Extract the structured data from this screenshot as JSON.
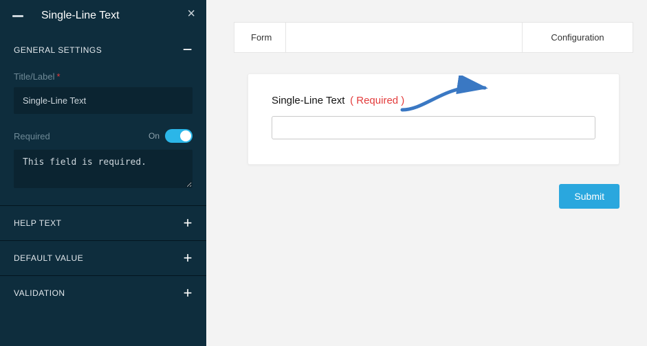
{
  "colors": {
    "sidebar_bg": "#0e2d3d",
    "accent": "#2aa7de",
    "toggle_on": "#2bb6e8",
    "required": "#e33b3b"
  },
  "sidebar": {
    "panel_title": "Single-Line Text",
    "sections": {
      "general": {
        "heading": "GENERAL SETTINGS",
        "title_label": "Title/Label",
        "title_value": "Single-Line Text",
        "required_label": "Required",
        "required_state_text": "On",
        "required_on": true,
        "required_message_value": "This field is required."
      },
      "help_text": {
        "heading": "HELP TEXT"
      },
      "default_value": {
        "heading": "DEFAULT VALUE"
      },
      "validation": {
        "heading": "VALIDATION"
      }
    }
  },
  "main": {
    "tabs": {
      "form": "Form",
      "config": "Configuration"
    },
    "preview": {
      "field_label": "Single-Line Text",
      "required_tag": "( Required )",
      "input_value": ""
    },
    "submit_label": "Submit"
  }
}
